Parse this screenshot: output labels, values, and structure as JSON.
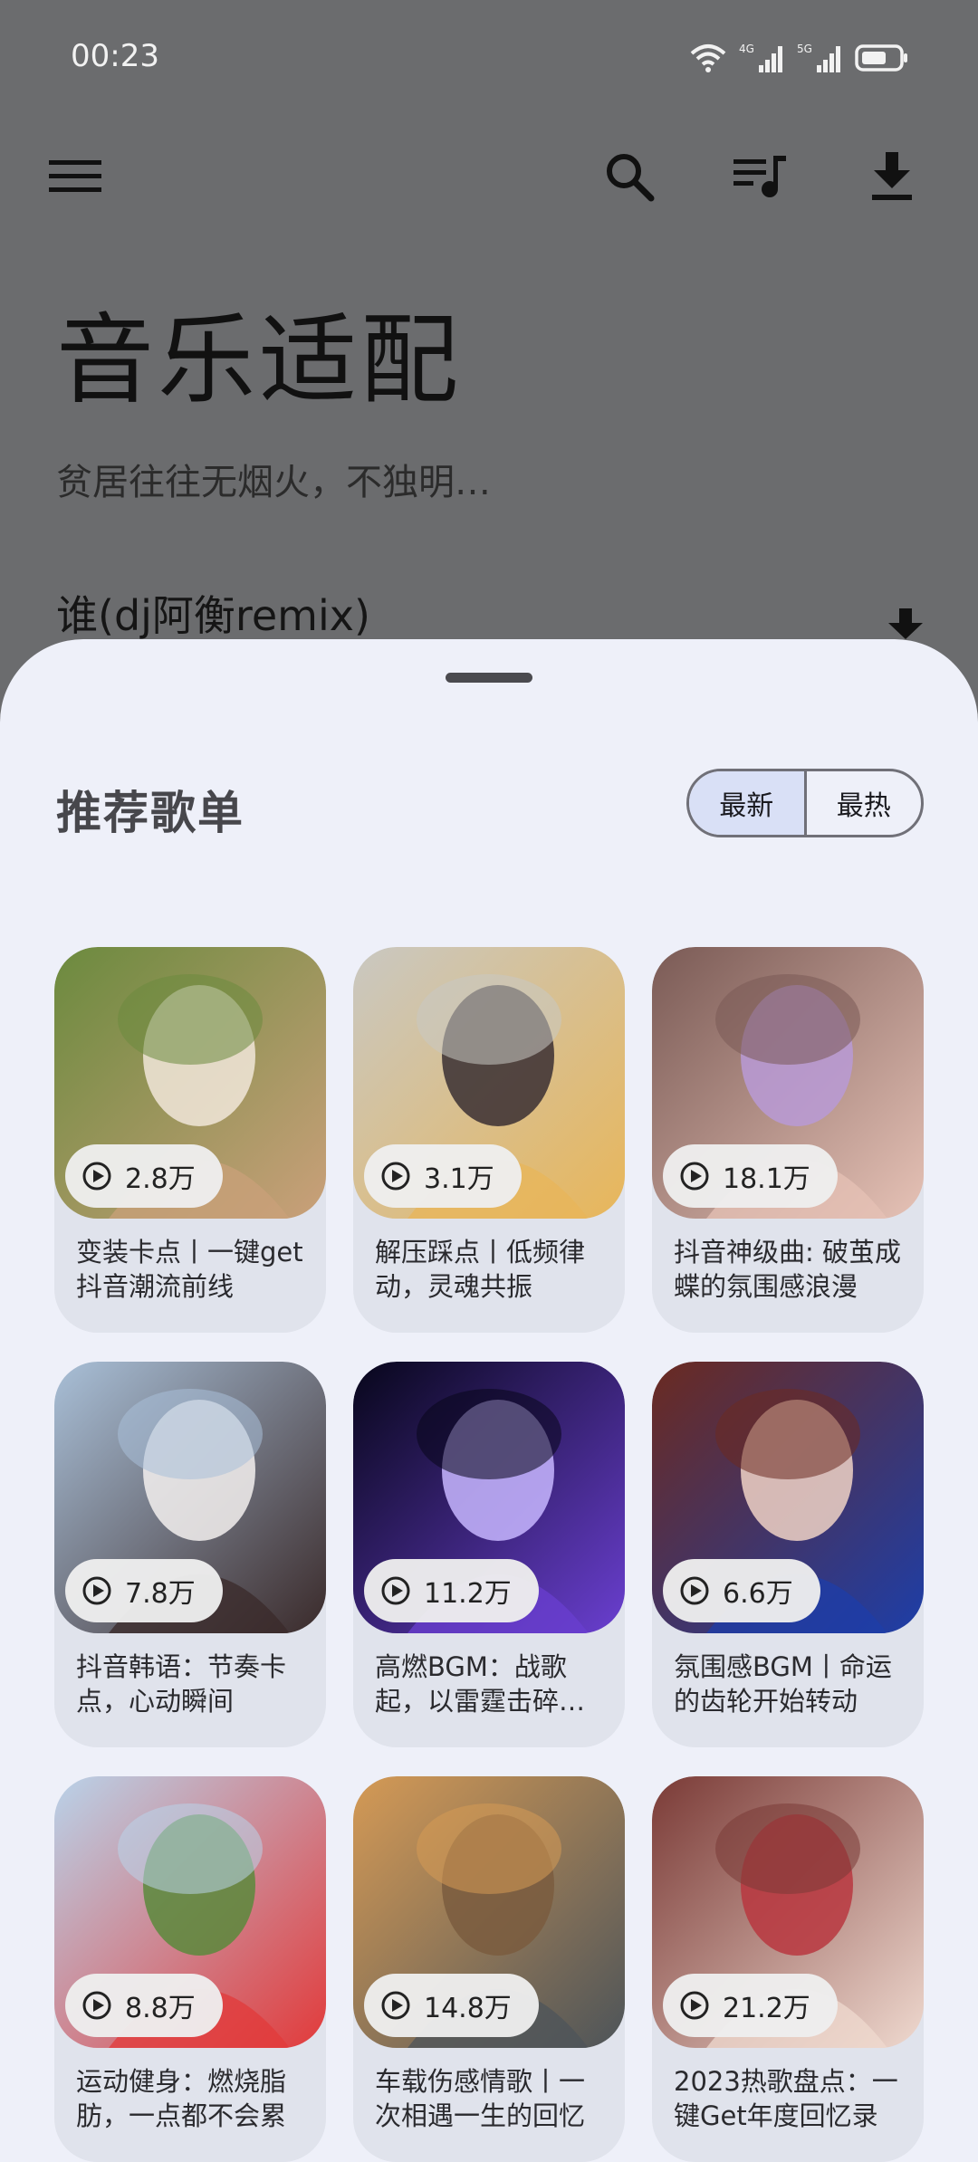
{
  "status_bar": {
    "time": "00:23",
    "net1": "4G",
    "net2": "5G"
  },
  "app": {
    "title": "音乐适配",
    "subtitle": "贫居往往无烟火，不独明…",
    "now_playing": "谁(dj阿衡remix)"
  },
  "toolbar": {
    "icons": [
      "menu-icon",
      "search-icon",
      "queue-music-icon",
      "download-icon"
    ]
  },
  "sheet": {
    "title": "推荐歌单",
    "segments": {
      "newest": "最新",
      "hottest": "最热",
      "selected": "最新"
    },
    "playlists": [
      {
        "title": "变装卡点丨一键get抖音潮流前线",
        "plays": "2.8万",
        "palette": [
          "#6b8a3e",
          "#caa07a",
          "#f1e6d9"
        ]
      },
      {
        "title": "解压踩点丨低频律动，灵魂共振",
        "plays": "3.1万",
        "palette": [
          "#c9c8c2",
          "#e8b65a",
          "#3a2f33"
        ]
      },
      {
        "title": "抖音神级曲: 破茧成蝶的氛围感浪漫",
        "plays": "18.1万",
        "palette": [
          "#7a5a55",
          "#e6c2b6",
          "#b89ad6"
        ]
      },
      {
        "title": "抖音韩语：节奏卡点，心动瞬间",
        "plays": "7.8万",
        "palette": [
          "#a9c0d8",
          "#3a2a2a",
          "#f3f0ee"
        ]
      },
      {
        "title": "高燃BGM：战歌起，以雷霆击碎黑暗",
        "plays": "11.2万",
        "palette": [
          "#07061a",
          "#6a3fd0",
          "#c7b6ff"
        ]
      },
      {
        "title": "氛围感BGM丨命运的齿轮开始转动",
        "plays": "6.6万",
        "palette": [
          "#6b2a20",
          "#1d3ea8",
          "#f0d2c6"
        ]
      },
      {
        "title": "运动健身：燃烧脂肪，一点都不会累",
        "plays": "8.8万",
        "palette": [
          "#b9d3ea",
          "#e23a3a",
          "#5b8a3c"
        ]
      },
      {
        "title": "车载伤感情歌丨一次相遇一生的回忆",
        "plays": "14.8万",
        "palette": [
          "#d59a55",
          "#4d5459",
          "#7a5c3e"
        ]
      },
      {
        "title": "2023热歌盘点：一键Get年度回忆录",
        "plays": "21.2万",
        "palette": [
          "#7a3a36",
          "#efd9cf",
          "#b8373f"
        ]
      }
    ]
  }
}
